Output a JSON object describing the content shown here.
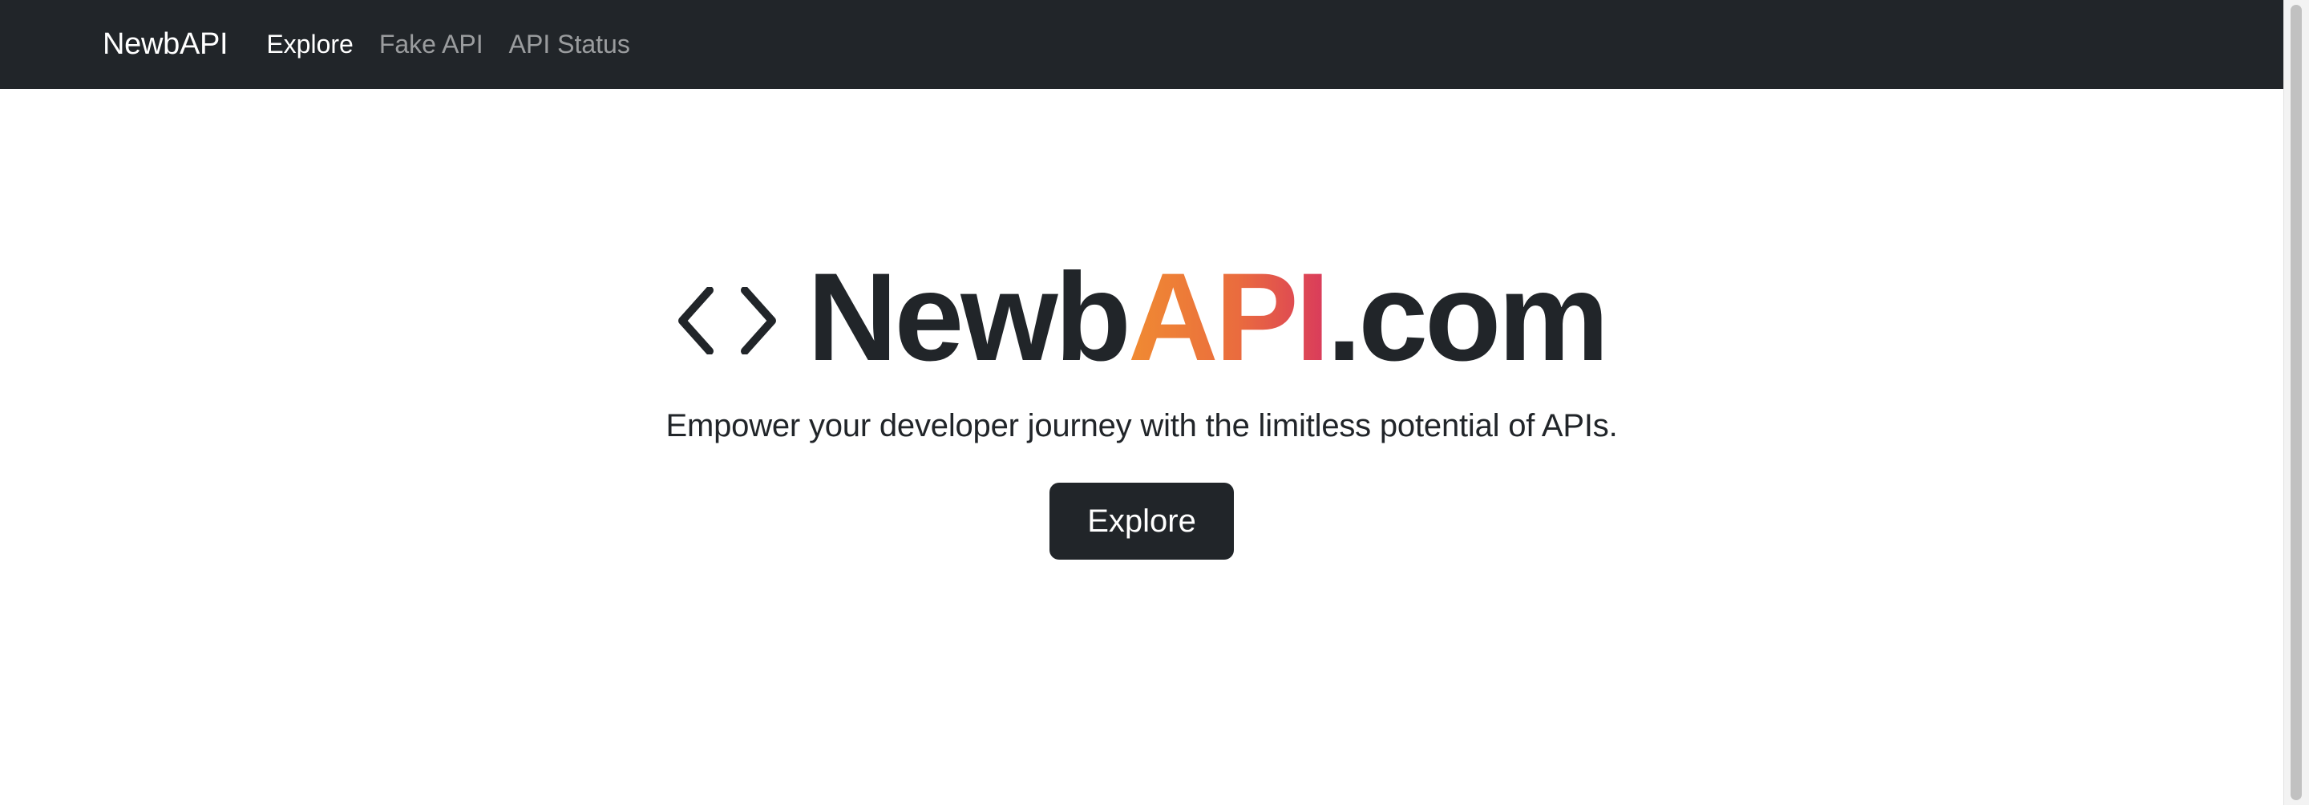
{
  "navbar": {
    "brand": "NewbAPI",
    "links": [
      {
        "label": "Explore",
        "active": true
      },
      {
        "label": "Fake API",
        "active": false
      },
      {
        "label": "API Status",
        "active": false
      }
    ]
  },
  "hero": {
    "icon": "code-icon",
    "title_prefix": "Newb",
    "title_highlight": "API",
    "title_suffix": ".com",
    "tagline": "Empower your developer journey with the limitless potential of APIs.",
    "cta_label": "Explore"
  },
  "colors": {
    "navbar_bg": "#212529",
    "text_dark": "#212529",
    "gradient_start": "#f08b32",
    "gradient_end": "#d93a5c"
  }
}
